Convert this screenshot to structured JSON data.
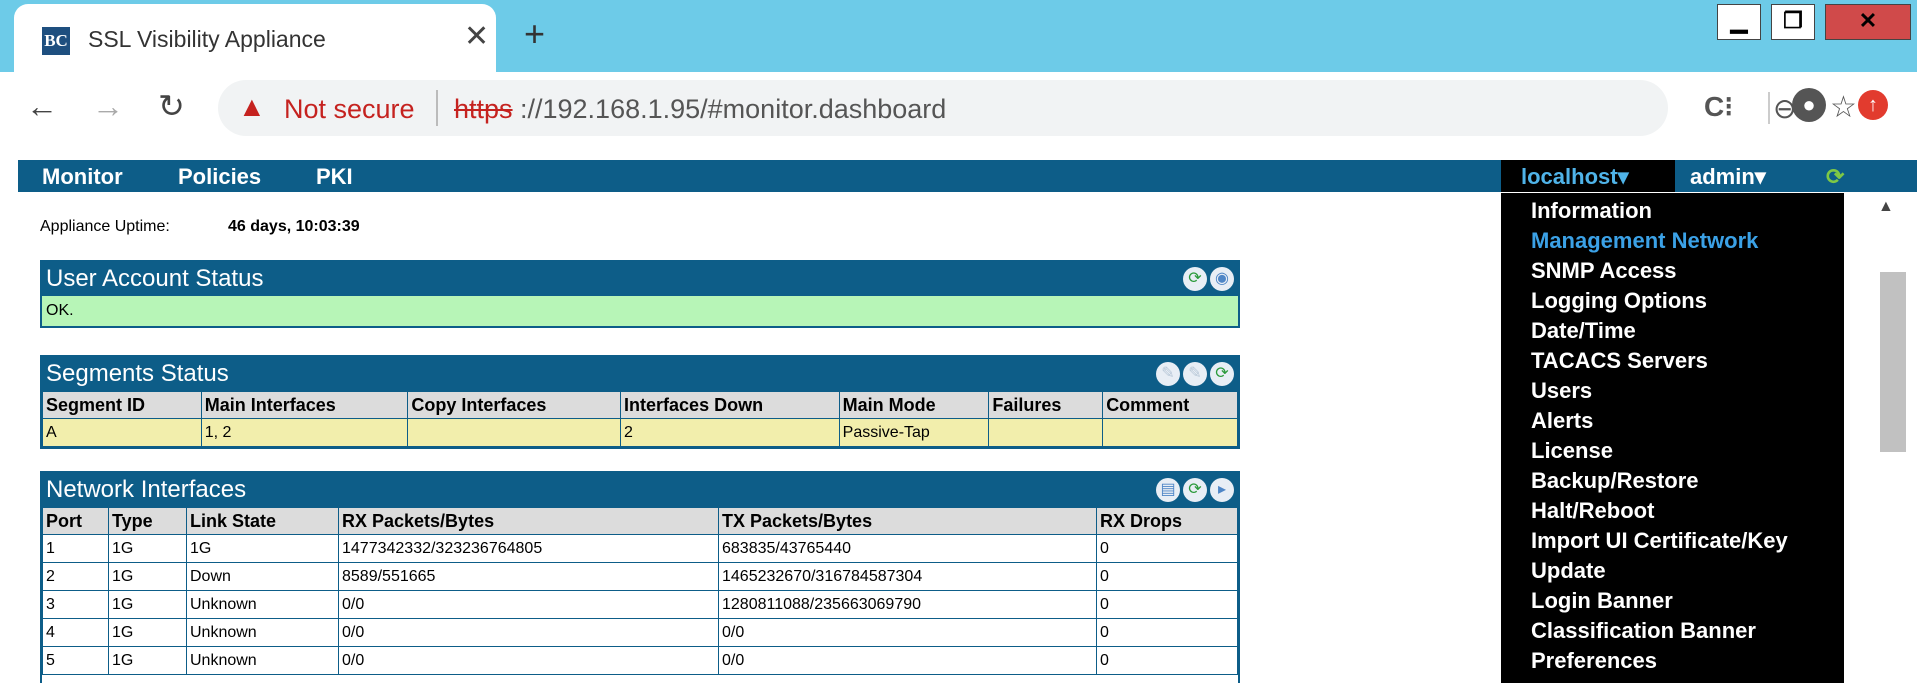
{
  "browser": {
    "tab_title": "SSL Visibility Appliance",
    "favicon_text": "BC",
    "not_secure": "Not secure",
    "url_scheme": "https",
    "url_rest": "://192.168.1.95/#monitor.dashboard",
    "icons": [
      "back-icon",
      "forward-icon",
      "reload-icon",
      "warning-icon",
      "zoom-icon",
      "star-icon",
      "extension-icon",
      "profile-icon",
      "update-icon"
    ]
  },
  "nav": {
    "monitor": "Monitor",
    "policies": "Policies",
    "pki": "PKI",
    "host": "localhost▾",
    "admin": "admin▾"
  },
  "uptime": {
    "label": "Appliance Uptime:",
    "value": "46 days, 10:03:39"
  },
  "user_account": {
    "title": "User Account Status",
    "status": "OK."
  },
  "segments": {
    "title": "Segments Status",
    "headers": [
      "Segment ID",
      "Main Interfaces",
      "Copy Interfaces",
      "Interfaces Down",
      "Main Mode",
      "Failures",
      "Comment"
    ],
    "rows": [
      [
        "A",
        "1, 2",
        "",
        "2",
        "Passive-Tap",
        "",
        ""
      ]
    ]
  },
  "network": {
    "title": "Network Interfaces",
    "headers": [
      "Port",
      "Type",
      "Link State",
      "RX Packets/Bytes",
      "TX Packets/Bytes",
      "RX Drops"
    ],
    "rows": [
      [
        "1",
        "1G",
        "1G",
        "1477342332/323236764805",
        "683835/43765440",
        "0"
      ],
      [
        "2",
        "1G",
        "Down",
        "8589/551665",
        "1465232670/316784587304",
        "0"
      ],
      [
        "3",
        "1G",
        "Unknown",
        "0/0",
        "1280811088/235663069790",
        "0"
      ],
      [
        "4",
        "1G",
        "Unknown",
        "0/0",
        "0/0",
        "0"
      ],
      [
        "5",
        "1G",
        "Unknown",
        "0/0",
        "0/0",
        "0"
      ]
    ]
  },
  "dropdown": {
    "items": [
      "Information",
      "Management Network",
      "SNMP Access",
      "Logging Options",
      "Date/Time",
      "TACACS Servers",
      "Users",
      "Alerts",
      "License",
      "Backup/Restore",
      "Halt/Reboot",
      "Import UI Certificate/Key",
      "Update",
      "Login Banner",
      "Classification Banner",
      "Preferences"
    ],
    "active_index": 1
  },
  "colors": {
    "nav_bar": "#0d5d88",
    "ok_status": "#b7f5b7",
    "segment_row": "#f2eeac",
    "menu_active": "#3ba1e6"
  }
}
